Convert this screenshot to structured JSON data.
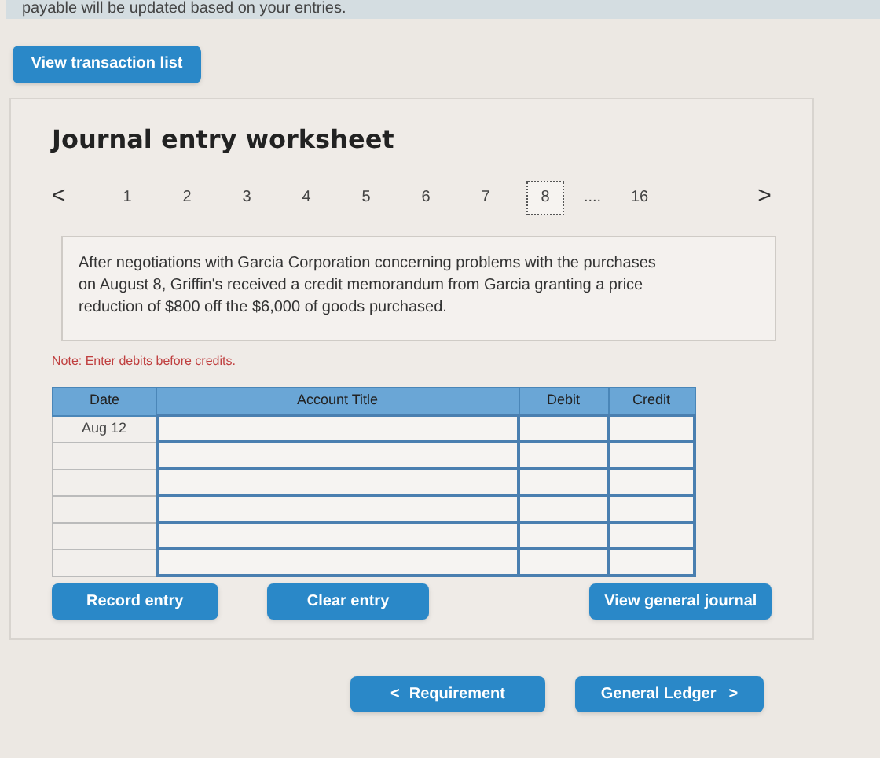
{
  "banner": {
    "text": "payable will be updated based on your entries."
  },
  "view_transaction_button": "View transaction list",
  "worksheet": {
    "title": "Journal entry worksheet",
    "pager": {
      "prev": "<",
      "next": ">",
      "pages": [
        {
          "label": "1",
          "selected": false
        },
        {
          "label": "2",
          "selected": false
        },
        {
          "label": "3",
          "selected": false
        },
        {
          "label": "4",
          "selected": false
        },
        {
          "label": "5",
          "selected": false
        },
        {
          "label": "6",
          "selected": false
        },
        {
          "label": "7",
          "selected": false
        },
        {
          "label": "8",
          "selected": true
        },
        {
          "label": "....",
          "kind": "ellipsis"
        },
        {
          "label": "16",
          "selected": false
        }
      ]
    },
    "description": "After negotiations with Garcia Corporation concerning problems with the purchases on August 8, Griffin's received a credit memorandum from Garcia granting a price reduction of $800 off the $6,000 of goods purchased.",
    "note": "Note: Enter debits before credits.",
    "table": {
      "columns": [
        "Date",
        "Account Title",
        "Debit",
        "Credit"
      ],
      "rows": [
        {
          "date": "Aug 12"
        },
        {
          "date": ""
        },
        {
          "date": ""
        },
        {
          "date": ""
        },
        {
          "date": ""
        },
        {
          "date": ""
        }
      ]
    },
    "buttons": [
      "Record entry",
      "Clear entry",
      "View general journal"
    ]
  },
  "footer": {
    "prev_arrow": "<",
    "prev": "Requirement",
    "next": "General Ledger",
    "next_arrow": ">"
  }
}
